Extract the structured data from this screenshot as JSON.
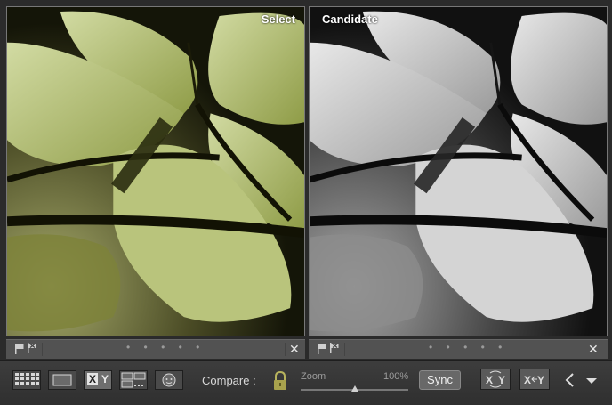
{
  "panes": {
    "left": {
      "label": "Select"
    },
    "right": {
      "label": "Candidate"
    }
  },
  "panebars": {
    "left": {
      "dots": "• • • • •",
      "close": "✕"
    },
    "right": {
      "dots": "• • • • •",
      "close": "✕"
    }
  },
  "toolbar": {
    "compare_label": "Compare :",
    "zoom_label": "Zoom",
    "zoom_value": "100%",
    "zoom_level_fraction": 0.5,
    "sync_label": "Sync",
    "xy_label": "X",
    "xy_label_y": "Y"
  },
  "colors": {
    "background": "#2b2b2b",
    "panebar": "#525252",
    "toolbar": "#3a3a3a",
    "leaf_light": "#c8d39a",
    "leaf_dark": "#4f5a22"
  },
  "icons": [
    "grid-view-icon",
    "loupe-view-icon",
    "compare-view-icon",
    "survey-view-icon",
    "people-view-icon",
    "lock-icon",
    "swap-icon",
    "make-select-icon",
    "left-arrow-icon",
    "chevron-down-icon",
    "flag-icon",
    "reject-flag-icon"
  ]
}
